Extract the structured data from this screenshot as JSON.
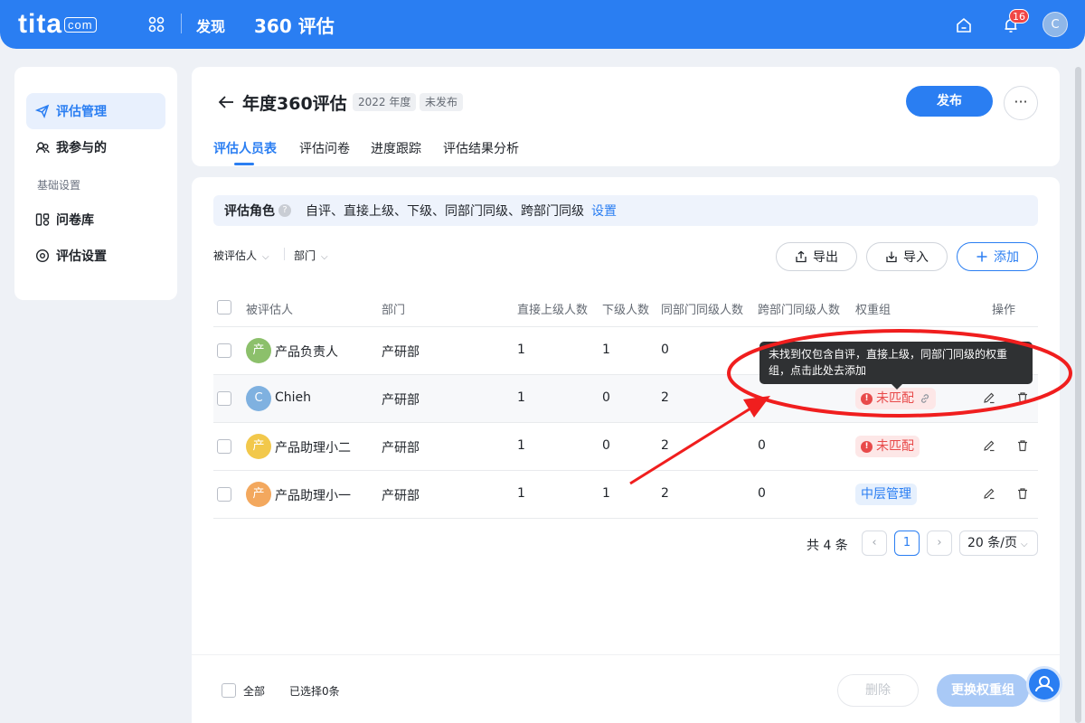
{
  "topbar": {
    "logo": "tita",
    "logo_suffix": "com",
    "nav_discover": "发现",
    "nav_title": "360 评估",
    "notification_count": "16",
    "user_initial": "C"
  },
  "sidebar": {
    "items": [
      {
        "label": "评估管理",
        "icon": "send-icon"
      },
      {
        "label": "我参与的",
        "icon": "people-icon"
      },
      {
        "label": "问卷库",
        "icon": "questionnaire-icon"
      },
      {
        "label": "评估设置",
        "icon": "settings-icon"
      }
    ],
    "group_label": "基础设置"
  },
  "header": {
    "title": "年度360评估",
    "year_tag": "2022 年度",
    "status_tag": "未发布",
    "publish_label": "发布",
    "more_label": "···",
    "tabs": [
      "评估人员表",
      "评估问卷",
      "进度跟踪",
      "评估结果分析"
    ]
  },
  "role_bar": {
    "label": "评估角色",
    "help": "?",
    "roles": "自评、直接上级、下级、同部门同级、跨部门同级",
    "link": "设置"
  },
  "filters": {
    "evaluatee": "被评估人",
    "department": "部门"
  },
  "toolbar": {
    "export_label": "导出",
    "import_label": "导入",
    "add_label": "添加"
  },
  "table": {
    "columns": [
      "被评估人",
      "部门",
      "直接上级人数",
      "下级人数",
      "同部门同级人数",
      "跨部门同级人数",
      "权重组",
      "操作"
    ],
    "rows": [
      {
        "avatar": "产",
        "avatar_color": "#8cc06b",
        "name": "产品负责人",
        "dept": "产研部",
        "sup": "1",
        "sub": "1",
        "peer": "0",
        "cross": "",
        "group": ""
      },
      {
        "avatar": "C",
        "avatar_color": "#7fb1e0",
        "name": "Chieh",
        "dept": "产研部",
        "sup": "1",
        "sub": "0",
        "peer": "2",
        "cross": "",
        "group": "未匹配"
      },
      {
        "avatar": "产",
        "avatar_color": "#f2c84b",
        "name": "产品助理小二",
        "dept": "产研部",
        "sup": "1",
        "sub": "0",
        "peer": "2",
        "cross": "0",
        "group": "未匹配"
      },
      {
        "avatar": "产",
        "avatar_color": "#f3a85e",
        "name": "产品助理小一",
        "dept": "产研部",
        "sup": "1",
        "sub": "1",
        "peer": "2",
        "cross": "0",
        "group": "中层管理"
      }
    ]
  },
  "tooltip": {
    "text": "未找到仅包含自评，直接上级，同部门同级的权重组，点击此处去添加"
  },
  "pagination": {
    "total": "共 4 条",
    "prev": "‹",
    "current": "1",
    "next": "›",
    "page_size": "20 条/页"
  },
  "footer": {
    "select_all": "全部",
    "selected": "已选择0条",
    "delete_label": "删除",
    "change_group_label": "更换权重组"
  },
  "colors": {
    "brand": "#2a7ef2",
    "warn": "#e84a4a",
    "annotation": "#f01e1e"
  }
}
